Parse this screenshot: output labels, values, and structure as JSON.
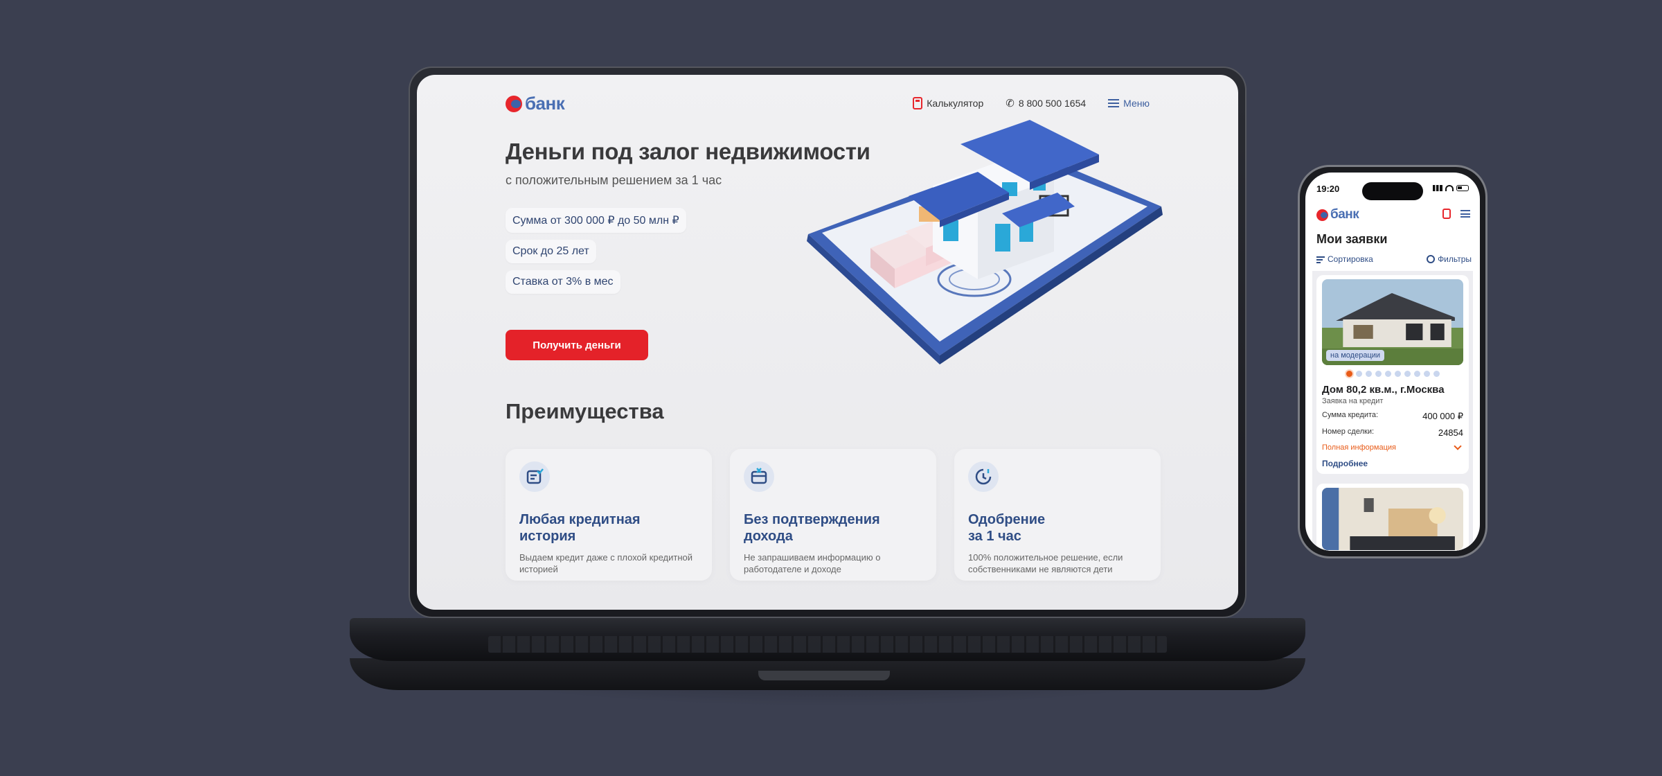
{
  "laptop": {
    "header": {
      "logo_text": "банк",
      "nav": [
        {
          "label": "Калькулятор",
          "icon": "calculator-icon"
        },
        {
          "label": "8 800 500 1654",
          "icon": "phone-icon"
        },
        {
          "label": "Меню",
          "icon": "menu-icon"
        }
      ]
    },
    "hero": {
      "title": "Деньги под залог недвижимости",
      "subtitle": "с положительным решением за 1 час",
      "features": [
        "Сумма от 300 000 ₽ до 50 млн ₽",
        "Срок до 25 лет",
        "Ставка от 3% в мес"
      ],
      "cta": "Получить деньги"
    },
    "advantages": {
      "title": "Преимущества",
      "cards": [
        {
          "title": "Любая кредитная\nистория",
          "text": "Выдаем кредит даже с плохой кредитной историей",
          "icon": "document-check-icon"
        },
        {
          "title": "Без подтверждения\nдохода",
          "text": "Не запрашиваем информацию о работодателе и доходе",
          "icon": "wallet-cross-icon"
        },
        {
          "title": "Одобрение\nза 1 час",
          "text": "100% положительное решение, если собственниками не являются дети",
          "icon": "clock-icon"
        }
      ]
    }
  },
  "phone": {
    "status_time": "19:20",
    "logo_text": "банк",
    "title": "Мои заявки",
    "sort_label": "Сортировка",
    "filter_label": "Фильтры",
    "card": {
      "badge": "на модерации",
      "name": "Дом 80,2 кв.м., г.Москва",
      "type": "Заявка на кредит",
      "amount_label": "Сумма кредита:",
      "amount_value": "400 000 ₽",
      "number_label": "Номер сделки:",
      "number_value": "24854",
      "full_info": "Полная информация",
      "details": "Подробнее"
    },
    "slider_dots": 10,
    "slider_active": 0
  },
  "colors": {
    "background": "#3b3f50",
    "accent_red": "#e42229",
    "brand_blue": "#2f4d85",
    "status_orange": "#e85b18"
  }
}
